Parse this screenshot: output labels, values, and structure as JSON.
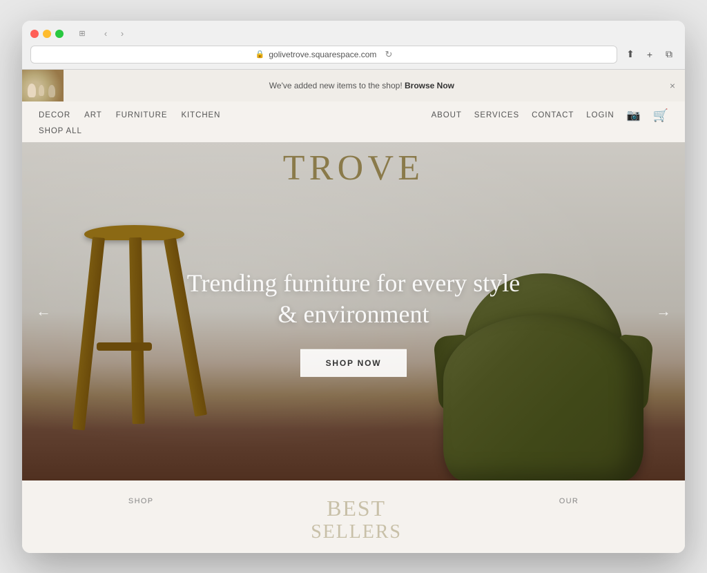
{
  "browser": {
    "url": "golivetrove.squarespace.com",
    "back_label": "‹",
    "forward_label": "›",
    "refresh_label": "↻",
    "share_label": "⬆",
    "add_tab_label": "+",
    "duplicate_label": "⧉",
    "sidebar_label": "⊞"
  },
  "announcement": {
    "text": "We've added new items to the shop! ",
    "link_text": "Browse Now",
    "close_label": "×"
  },
  "nav": {
    "left_items": [
      "DECOR",
      "ART",
      "FURNITURE",
      "KITCHEN"
    ],
    "shop_all": "SHOP ALL",
    "right_items": [
      "ABOUT",
      "SERVICES",
      "CONTACT",
      "LOGIN"
    ]
  },
  "hero": {
    "logo": "TROVE",
    "headline": "Trending furniture for every style & environment",
    "cta_button": "SHOP NOW",
    "arrow_left": "←",
    "arrow_right": "→"
  },
  "below_fold": {
    "left_label": "SHOP",
    "center_heading_line1": "BEST",
    "center_heading_line2": "SELLERS",
    "right_label": "OUR"
  }
}
